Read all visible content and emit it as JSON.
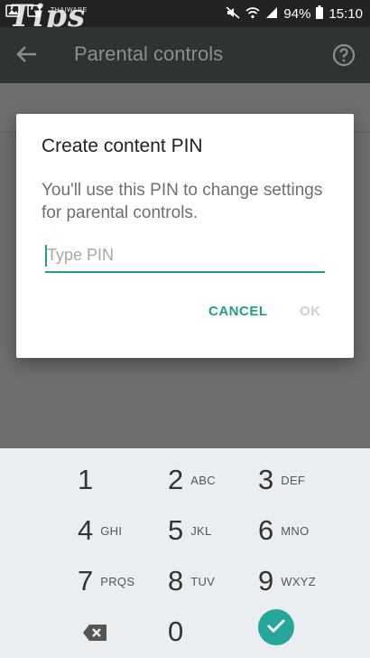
{
  "status_bar": {
    "battery": "94%",
    "time": "15:10",
    "watermark": "Tips",
    "watermark_sub": "THAIWARE"
  },
  "app_bar": {
    "title": "Parental controls",
    "back_icon": "arrow-back-icon",
    "help_icon": "help-circle-icon"
  },
  "dialog": {
    "title": "Create content PIN",
    "message": "You'll use this PIN to change settings for parental controls.",
    "pin_placeholder": "Type PIN",
    "pin_value": "",
    "cancel_label": "CANCEL",
    "ok_label": "OK"
  },
  "keypad": {
    "keys": [
      {
        "digit": "1",
        "letters": ""
      },
      {
        "digit": "2",
        "letters": "ABC"
      },
      {
        "digit": "3",
        "letters": "DEF"
      },
      {
        "digit": "4",
        "letters": "GHI"
      },
      {
        "digit": "5",
        "letters": "JKL"
      },
      {
        "digit": "6",
        "letters": "MNO"
      },
      {
        "digit": "7",
        "letters": "PRQS"
      },
      {
        "digit": "8",
        "letters": "TUV"
      },
      {
        "digit": "9",
        "letters": "WXYZ"
      },
      {
        "digit": "0",
        "letters": ""
      }
    ],
    "backspace_icon": "backspace-icon",
    "done_icon": "check-icon"
  },
  "colors": {
    "accent": "#1f9e8a",
    "done_button": "#26a69a",
    "app_bar": "#2e3433",
    "scrim": "#6e6e6e"
  }
}
